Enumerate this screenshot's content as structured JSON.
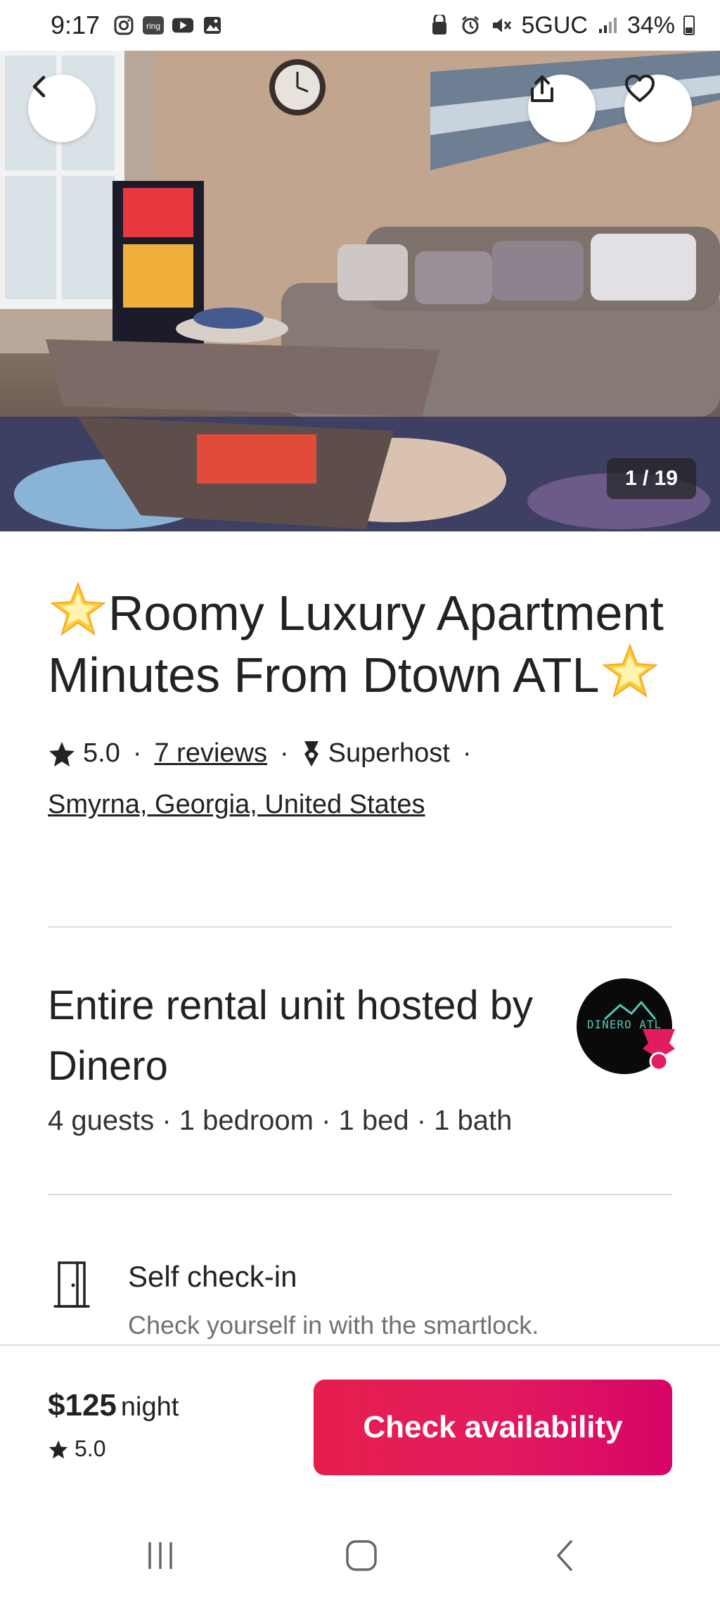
{
  "status_bar": {
    "time": "9:17",
    "network": "5GUC",
    "battery": "34%",
    "left_icons": [
      "instagram-icon",
      "ring-icon",
      "youtube-icon",
      "gallery-icon"
    ],
    "right_icons": [
      "recycle-icon",
      "alarm-icon",
      "mute-icon",
      "signal-icon",
      "battery-icon"
    ]
  },
  "hero": {
    "counter": "1 / 19",
    "back_icon": "chevron-left-icon",
    "share_icon": "share-icon",
    "favorite_icon": "heart-icon"
  },
  "listing": {
    "title": "Roomy Luxury Apartment Minutes From Dtown ATL",
    "rating": "5.0",
    "reviews": "7 reviews",
    "host_status": "Superhost",
    "location": "Smyrna, Georgia, United States"
  },
  "host": {
    "title": "Entire rental unit hosted by Dinero",
    "details": "4 guests · 1 bedroom · 1 bed · 1 bath",
    "avatar_text": "DINERO ATL"
  },
  "feature": {
    "title": "Self check-in",
    "description": "Check yourself in with the smartlock."
  },
  "footer": {
    "price": "$125",
    "price_unit": "night",
    "rating": "5.0",
    "cta": "Check availability"
  },
  "colors": {
    "accent": "#e61e4d",
    "text": "#222222",
    "secondary_text": "#717171",
    "divider": "#dddddd"
  }
}
